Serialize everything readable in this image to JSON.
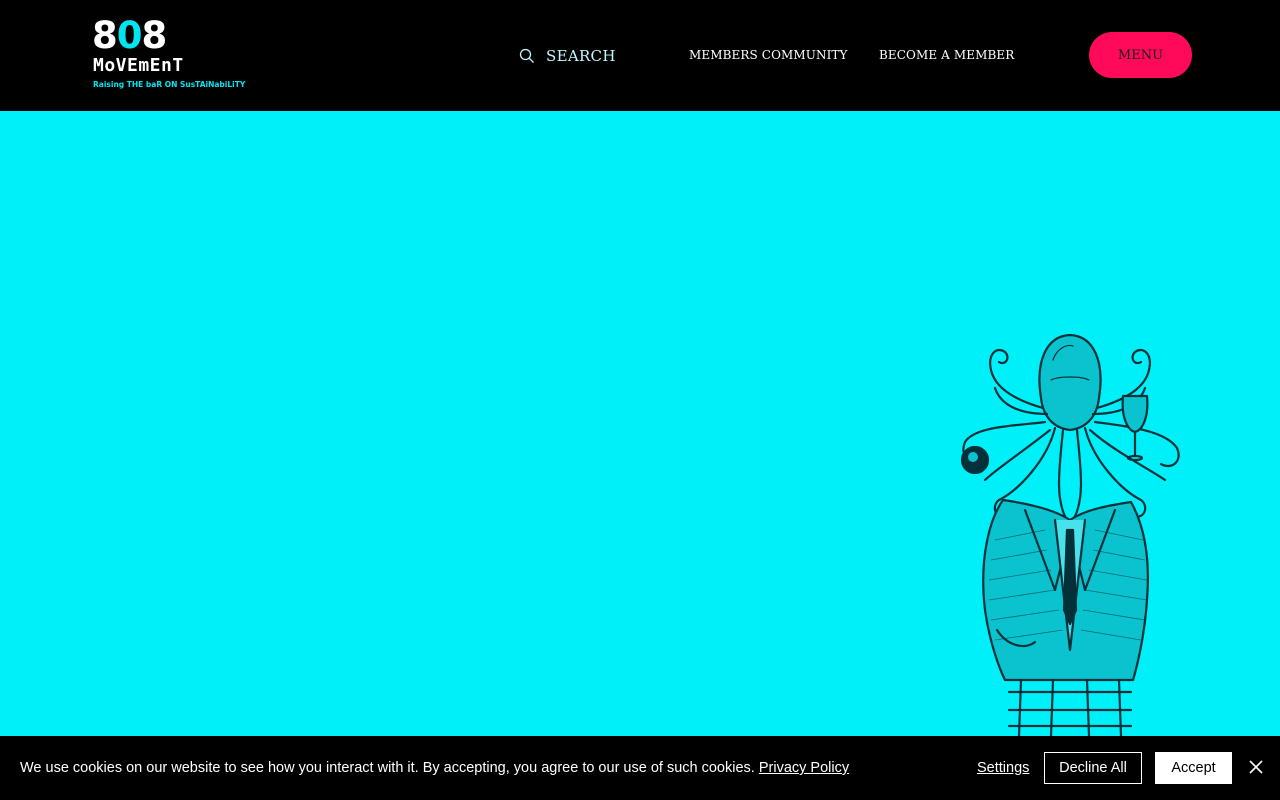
{
  "header": {
    "logo": {
      "number_a": "8",
      "number_b": "0",
      "number_c": "8",
      "word": "MoVEmEnT",
      "tagline": "Raising THE baR ON SusTAiNabiLiTY"
    },
    "search_label": "SEARCH",
    "nav": {
      "members_community": "MEMBERS COMMUNITY",
      "become_member": "BECOME A MEMBER"
    },
    "menu_label": "MENU"
  },
  "hero": {
    "illustration_icon": "octopus-in-suit-icon",
    "background_color": "#00F0FA"
  },
  "cookie_bar": {
    "message": "We use cookies on our website to see how you interact with it. By accepting, you agree to our use of such cookies.",
    "privacy_link": "Privacy Policy",
    "settings_label": "Settings",
    "decline_label": "Decline All",
    "accept_label": "Accept",
    "close_icon": "close-icon"
  },
  "colors": {
    "header_bg": "#000000",
    "accent_pink": "#FF0A5B",
    "accent_cyan": "#00F0FA"
  }
}
